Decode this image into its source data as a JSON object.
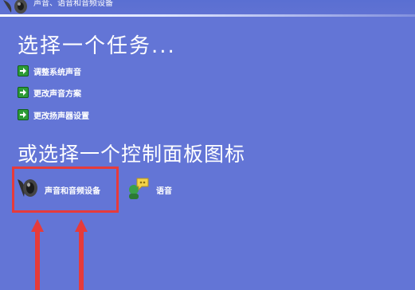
{
  "header": {
    "title": "声音、语音和音频设备",
    "icon": "speaker-icon"
  },
  "tasks": {
    "heading": "选择一个任务...",
    "items": [
      {
        "label": "调整系统声音",
        "icon": "green-arrow-icon"
      },
      {
        "label": "更改声音方案",
        "icon": "green-arrow-icon"
      },
      {
        "label": "更改扬声器设置",
        "icon": "green-arrow-icon"
      }
    ]
  },
  "control_panel": {
    "heading": "或选择一个控制面板图标",
    "items": [
      {
        "label": "声音和音频设备",
        "icon": "speaker-icon"
      },
      {
        "label": "语音",
        "icon": "speech-icon"
      }
    ]
  },
  "annotation": {
    "highlight_color": "#e63b3b"
  },
  "colors": {
    "background": "#6375d6",
    "text": "#ffffff",
    "task_arrow": "#2d9b37"
  }
}
